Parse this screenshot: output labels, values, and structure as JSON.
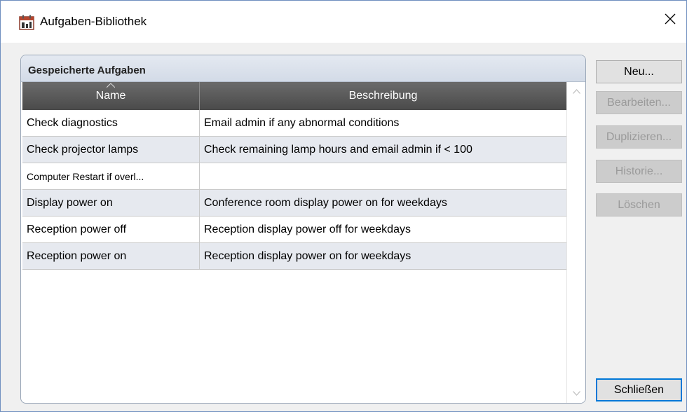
{
  "window": {
    "title": "Aufgaben-Bibliothek",
    "app_icon": "calendar-tasks-icon",
    "close_icon": "close-icon"
  },
  "group": {
    "title": "Gespeicherte Aufgaben"
  },
  "grid": {
    "columns": [
      "Name",
      "Beschreibung"
    ],
    "sort_column": "Name",
    "rows": [
      {
        "name": "Check diagnostics",
        "description": "Email admin if any abnormal conditions"
      },
      {
        "name": "Check projector lamps",
        "description": "Check remaining lamp hours and email admin if < 100"
      },
      {
        "name": "Computer Restart if overl...",
        "description": ""
      },
      {
        "name": "Display power on",
        "description": "Conference room display power on for weekdays"
      },
      {
        "name": "Reception power off",
        "description": "Reception display power off for weekdays"
      },
      {
        "name": "Reception power on",
        "description": "Reception display power on for weekdays"
      }
    ]
  },
  "buttons": {
    "new": "Neu...",
    "edit": "Bearbeiten...",
    "duplicate": "Duplizieren...",
    "history": "Historie...",
    "delete": "Löschen",
    "close": "Schließen"
  },
  "colors": {
    "header_bg": "#555555",
    "row_alt": "#e6e9ef",
    "default_button_border": "#0078d7"
  }
}
